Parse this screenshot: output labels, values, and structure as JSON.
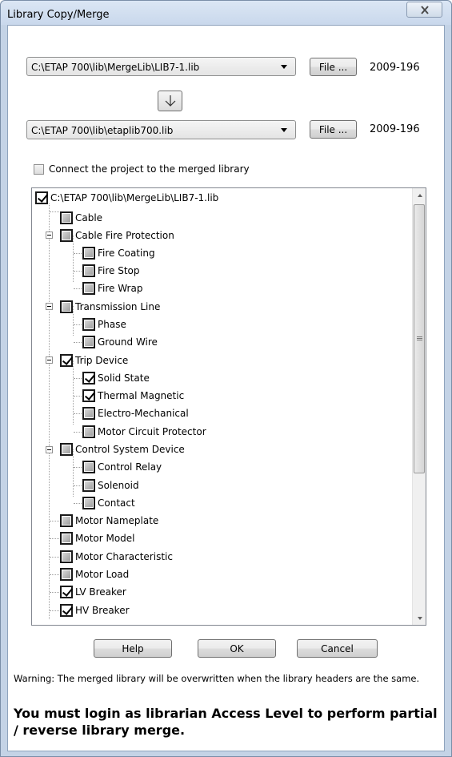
{
  "window": {
    "title": "Library Copy/Merge"
  },
  "source": {
    "path": "C:\\ETAP 700\\lib\\MergeLib\\LIB7-1.lib",
    "file_button": "File ...",
    "version": "2009-196"
  },
  "target": {
    "path": "C:\\ETAP 700\\lib\\etaplib700.lib",
    "file_button": "File ...",
    "version": "2009-196"
  },
  "connect_checkbox": {
    "label": "Connect the project to the merged library",
    "checked": false
  },
  "tree": {
    "root": {
      "label": "C:\\ETAP 700\\lib\\MergeLib\\LIB7-1.lib",
      "checked": true
    },
    "items": [
      {
        "label": "Cable",
        "checked": false
      },
      {
        "label": "Cable Fire Protection",
        "checked": false
      },
      {
        "label": "Fire Coating",
        "checked": false
      },
      {
        "label": "Fire Stop",
        "checked": false
      },
      {
        "label": "Fire Wrap",
        "checked": false
      },
      {
        "label": "Transmission Line",
        "checked": false
      },
      {
        "label": "Phase",
        "checked": false
      },
      {
        "label": "Ground Wire",
        "checked": false
      },
      {
        "label": "Trip Device",
        "checked": true
      },
      {
        "label": "Solid State",
        "checked": true
      },
      {
        "label": "Thermal Magnetic",
        "checked": true
      },
      {
        "label": "Electro-Mechanical",
        "checked": false
      },
      {
        "label": "Motor Circuit Protector",
        "checked": false
      },
      {
        "label": "Control System Device",
        "checked": false
      },
      {
        "label": "Control Relay",
        "checked": false
      },
      {
        "label": "Solenoid",
        "checked": false
      },
      {
        "label": "Contact",
        "checked": false
      },
      {
        "label": "Motor Nameplate",
        "checked": false
      },
      {
        "label": "Motor Model",
        "checked": false
      },
      {
        "label": "Motor Characteristic",
        "checked": false
      },
      {
        "label": "Motor Load",
        "checked": false
      },
      {
        "label": "LV Breaker",
        "checked": true
      },
      {
        "label": "HV Breaker",
        "checked": true
      }
    ]
  },
  "buttons": {
    "help": "Help",
    "ok": "OK",
    "cancel": "Cancel"
  },
  "warning_text": "Warning: The merged library will be overwritten when the library headers are the same.",
  "librarian_message": "You must login as librarian Access Level to perform partial / reverse library merge."
}
